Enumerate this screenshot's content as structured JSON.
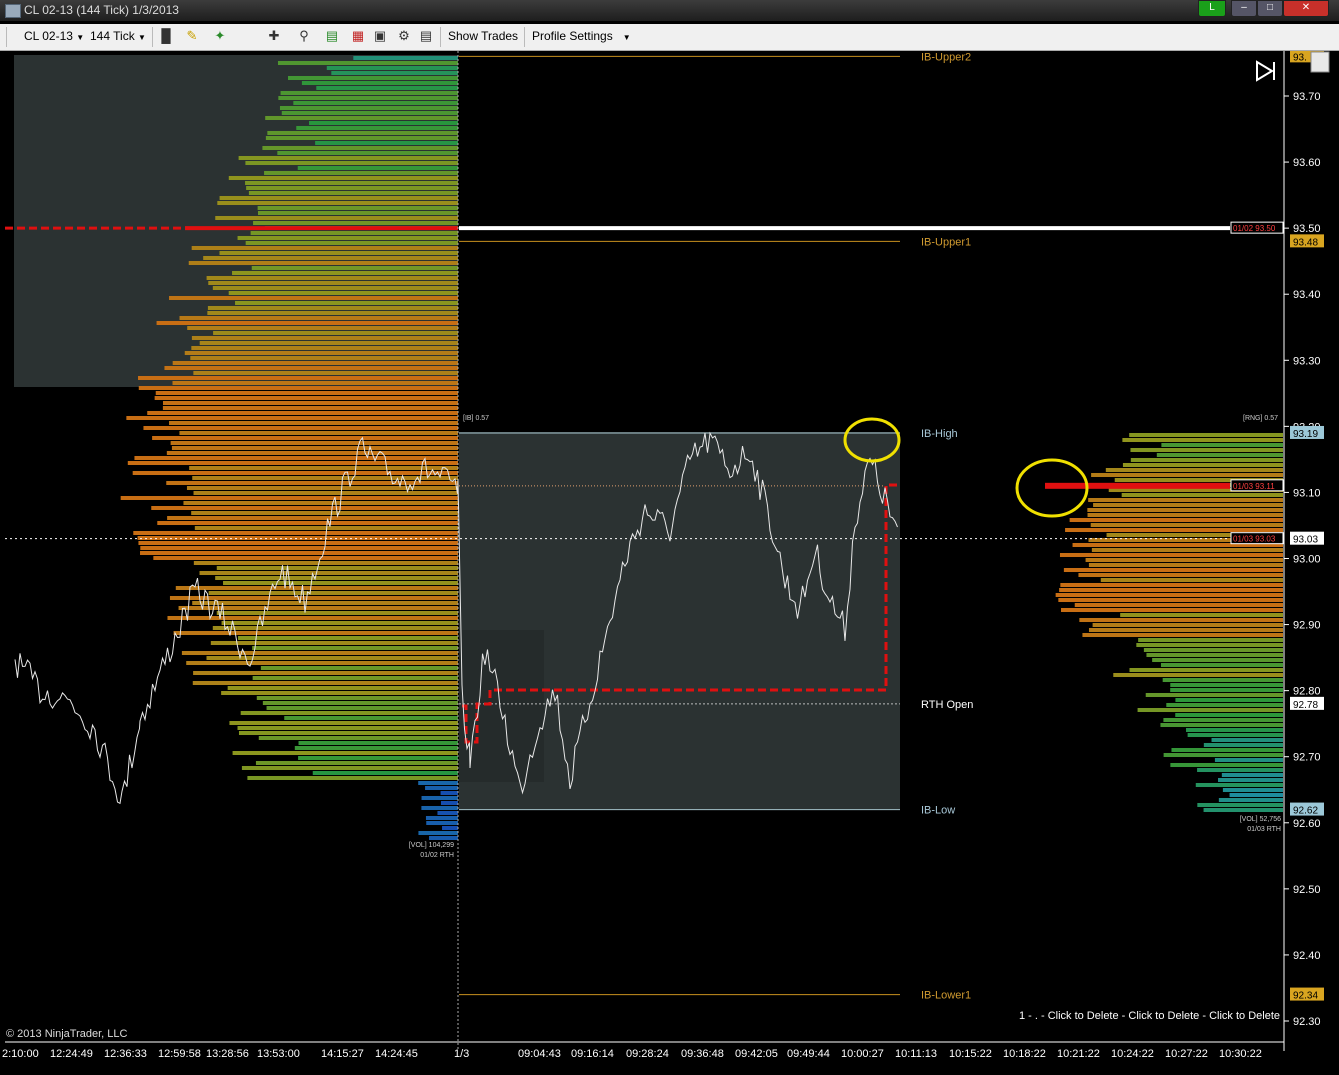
{
  "window": {
    "title": "CL 02-13 (144 Tick)  1/3/2013",
    "connection_status": "L"
  },
  "toolbar": {
    "instrument": "CL 02-13",
    "period": "144 Tick",
    "show_trades": "Show Trades",
    "profile_settings": "Profile Settings"
  },
  "price_axis": {
    "ticks": [
      "93.70",
      "93.60",
      "93.50",
      "93.40",
      "93.30",
      "93.20",
      "93.10",
      "93.00",
      "92.90",
      "92.80",
      "92.70",
      "92.60",
      "92.50",
      "92.40",
      "92.30"
    ],
    "range": [
      92.28,
      93.76
    ],
    "markers": [
      {
        "label": "93.",
        "price": 93.76,
        "color": "#d9a520"
      },
      {
        "label": "93.48",
        "price": 93.48,
        "color": "#d9a520"
      },
      {
        "label": "93.19",
        "price": 93.19,
        "color": "#9cc8d8"
      },
      {
        "label": "93.03",
        "price": 93.03,
        "color": "#ffffff"
      },
      {
        "label": "92.78",
        "price": 92.78,
        "color": "#ffffff"
      },
      {
        "label": "92.62",
        "price": 92.62,
        "color": "#9cc8d8"
      },
      {
        "label": "92.34",
        "price": 92.34,
        "color": "#d9a520"
      }
    ]
  },
  "time_axis": {
    "labels": [
      "2:10:00",
      "12:24:49",
      "12:36:33",
      "12:59:58",
      "13:28:56",
      "13:53:00",
      "14:15:27",
      "14:24:45",
      "1/3",
      "09:04:43",
      "09:16:14",
      "09:28:24",
      "09:36:48",
      "09:42:05",
      "09:49:44",
      "10:00:27",
      "10:11:13",
      "10:15:22",
      "10:18:22",
      "10:21:22",
      "10:24:22",
      "10:27:22",
      "10:30:22"
    ]
  },
  "levels": {
    "ib_upper2": {
      "label": "IB-Upper2",
      "price": 93.76
    },
    "ib_upper1": {
      "label": "IB-Upper1",
      "price": 93.48
    },
    "ib_high": {
      "label": "IB-High",
      "price": 93.19
    },
    "rth_open": {
      "label": "RTH Open",
      "price": 92.78
    },
    "ib_low": {
      "label": "IB-Low",
      "price": 92.62
    },
    "ib_lower1": {
      "label": "IB-Lower1",
      "price": 92.34
    }
  },
  "tags": {
    "poc_prev": {
      "label": "01/02 93.50",
      "price": 93.5
    },
    "poc_today": {
      "label": "01/03 93.11",
      "price": 93.11
    },
    "last_price": {
      "label": "01/03 93.03",
      "price": 93.03
    },
    "ib_range": "[IB] 0.57",
    "rng": "[RNG] 0.57",
    "vol_prev": "[VOL] 104,299",
    "vol_prev_sub": "01/02 RTH",
    "vol_today": "[VOL] 52,756",
    "vol_today_sub": "01/03 RTH"
  },
  "footer": {
    "copyright": "© 2013 NinjaTrader, LLC",
    "delete_text": "1 -  . - Click to Delete - Click to Delete - Click to Delete"
  }
}
